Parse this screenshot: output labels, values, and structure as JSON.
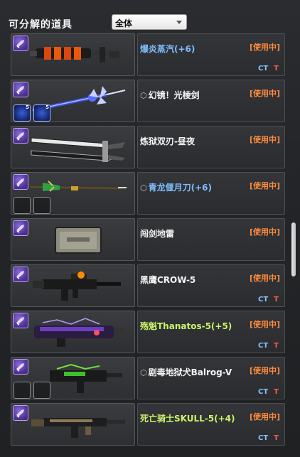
{
  "header": {
    "title": "可分解的道具",
    "filter_value": "全体"
  },
  "colors": {
    "status": "#ff8a3d",
    "ct": "#7fc4ff",
    "t": "#ff5a4a",
    "name_white": "#f4f4f4",
    "name_blue": "#7fbcff",
    "name_green": "#c9f26a",
    "category_icon": "#6b4bc0"
  },
  "items": [
    {
      "name": "爆炎蒸汽(+6)",
      "locked": false,
      "name_color": "blue",
      "status": "[使用中]",
      "ct": "CT",
      "t": "T",
      "slots": [],
      "weapon_icon": "steam-gun-icon"
    },
    {
      "name": "幻镜！光棱剑",
      "locked": true,
      "name_color": "white",
      "status": "[使用中]",
      "ct": "",
      "t": "",
      "slots": [
        {
          "count": "5"
        },
        {
          "count": "5"
        }
      ],
      "weapon_icon": "prism-sword-icon"
    },
    {
      "name": "炼狱双刃-昼夜",
      "locked": false,
      "name_color": "white",
      "status": "[使用中]",
      "ct": "",
      "t": "",
      "slots": [],
      "weapon_icon": "dual-blade-icon"
    },
    {
      "name": "青龙偃月刀(+6)",
      "locked": true,
      "name_color": "blue",
      "status": "[使用中]",
      "ct": "",
      "t": "",
      "slots": [
        {
          "count": ""
        },
        {
          "count": ""
        }
      ],
      "weapon_icon": "glaive-icon"
    },
    {
      "name": "闯剑地雷",
      "locked": false,
      "name_color": "white",
      "status": "[使用中]",
      "ct": "",
      "t": "",
      "slots": [],
      "weapon_icon": "mine-icon"
    },
    {
      "name": "黑鹰CROW-5",
      "locked": false,
      "name_color": "white",
      "status": "[使用中]",
      "ct": "CT",
      "t": "T",
      "slots": [],
      "weapon_icon": "rifle-icon"
    },
    {
      "name": "殇魁Thanatos-5(+5)",
      "locked": false,
      "name_color": "green",
      "status": "[使用中]",
      "ct": "CT",
      "t": "T",
      "slots": [],
      "weapon_icon": "launcher-icon"
    },
    {
      "name": "剧毒地狱犬Balrog-V",
      "locked": true,
      "name_color": "white",
      "status": "[使用中]",
      "ct": "CT",
      "t": "T",
      "slots": [
        {
          "count": ""
        },
        {
          "count": ""
        }
      ],
      "weapon_icon": "smg-icon"
    },
    {
      "name": "死亡骑士SKULL-5(+4)",
      "locked": false,
      "name_color": "green",
      "status": "[使用中]",
      "ct": "CT",
      "t": "T",
      "slots": [],
      "weapon_icon": "skull-rifle-icon"
    }
  ]
}
